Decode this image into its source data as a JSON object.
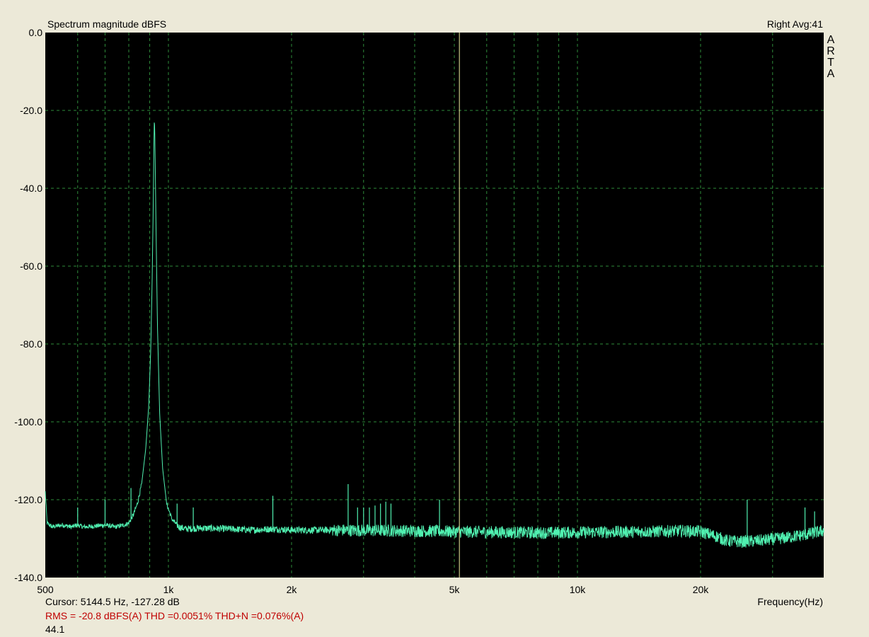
{
  "header": {
    "title": "Spectrum magnitude dBFS",
    "channel_avg": "Right  Avg:41",
    "logo_letters": [
      "A",
      "R",
      "T",
      "A"
    ]
  },
  "footer": {
    "cursor": "Cursor:  5144.5 Hz, -127.28 dB",
    "stats": "RMS =  -20.8 dBFS(A)   THD =0.0051%   THD+N =0.076%(A)",
    "sample_rate": "44.1"
  },
  "colors": {
    "plot_bg": "#000000",
    "grid": "#2e8b3a",
    "trace": "#50f0b0",
    "cursor": "#f0f0a0",
    "window_bg": "#ece9d8",
    "stats_text": "#c00000"
  },
  "chart_data": {
    "type": "line",
    "title": "Spectrum magnitude dBFS",
    "xlabel": "Frequency(Hz)",
    "ylabel": "",
    "x_scale": "log",
    "xlim": [
      500,
      40000
    ],
    "ylim": [
      -140,
      0
    ],
    "grid": true,
    "y_ticks": [
      0,
      -20,
      -40,
      -60,
      -80,
      -100,
      -120,
      -140
    ],
    "y_tick_labels": [
      "0.0",
      "-20.0",
      "-40.0",
      "-60.0",
      "-80.0",
      "-100.0",
      "-120.0",
      "-140.0"
    ],
    "x_ticks": [
      500,
      1000,
      2000,
      5000,
      10000,
      20000
    ],
    "x_tick_labels": [
      "500",
      "1k",
      "2k",
      "5k",
      "10k",
      "20k"
    ],
    "x_minor_grid": [
      600,
      700,
      800,
      900,
      3000,
      4000,
      6000,
      7000,
      8000,
      9000,
      30000,
      40000
    ],
    "cursor_x": 5144.5,
    "series": [
      {
        "points": [
          [
            500,
            -118
          ],
          [
            505,
            -126
          ],
          [
            520,
            -127
          ],
          [
            550,
            -126.5
          ],
          [
            580,
            -127
          ],
          [
            600,
            -126.5
          ],
          [
            620,
            -127
          ],
          [
            660,
            -126.8
          ],
          [
            700,
            -126.5
          ],
          [
            740,
            -127
          ],
          [
            780,
            -126.5
          ],
          [
            800,
            -126
          ],
          [
            820,
            -124
          ],
          [
            840,
            -121
          ],
          [
            860,
            -116
          ],
          [
            880,
            -107
          ],
          [
            895,
            -96
          ],
          [
            905,
            -82
          ],
          [
            912,
            -65
          ],
          [
            918,
            -45
          ],
          [
            921,
            -30
          ],
          [
            924,
            -21.5
          ],
          [
            927,
            -28
          ],
          [
            932,
            -48
          ],
          [
            940,
            -75
          ],
          [
            952,
            -98
          ],
          [
            968,
            -112
          ],
          [
            990,
            -121
          ],
          [
            1020,
            -125
          ],
          [
            1060,
            -127
          ],
          [
            1100,
            -127.5
          ],
          [
            1200,
            -127.3
          ],
          [
            1400,
            -127.5
          ],
          [
            1600,
            -127.8
          ],
          [
            1800,
            -127.5
          ],
          [
            2000,
            -127.8
          ],
          [
            2500,
            -127.8
          ],
          [
            3000,
            -127.9
          ],
          [
            4000,
            -128
          ],
          [
            5000,
            -128.2
          ],
          [
            6000,
            -128.3
          ],
          [
            8000,
            -128.5
          ],
          [
            10000,
            -128.4
          ],
          [
            12000,
            -128.3
          ],
          [
            15000,
            -128.2
          ],
          [
            18000,
            -128
          ],
          [
            20000,
            -128.2
          ],
          [
            22000,
            -129.5
          ],
          [
            23000,
            -130.5
          ],
          [
            25000,
            -130.8
          ],
          [
            28000,
            -130.5
          ],
          [
            32000,
            -129.8
          ],
          [
            36000,
            -129
          ],
          [
            40000,
            -128
          ]
        ],
        "spikes": [
          [
            500,
            -118
          ],
          [
            600,
            -122
          ],
          [
            700,
            -120
          ],
          [
            810,
            -117
          ],
          [
            1050,
            -121
          ],
          [
            1150,
            -122
          ],
          [
            1800,
            -119
          ],
          [
            2750,
            -116
          ],
          [
            2900,
            -122
          ],
          [
            3000,
            -122
          ],
          [
            3100,
            -122
          ],
          [
            3200,
            -121.5
          ],
          [
            3300,
            -121
          ],
          [
            3400,
            -120.5
          ],
          [
            3500,
            -121
          ],
          [
            4600,
            -120
          ],
          [
            26000,
            -120
          ],
          [
            36000,
            -122
          ],
          [
            38000,
            -123
          ]
        ]
      }
    ]
  }
}
